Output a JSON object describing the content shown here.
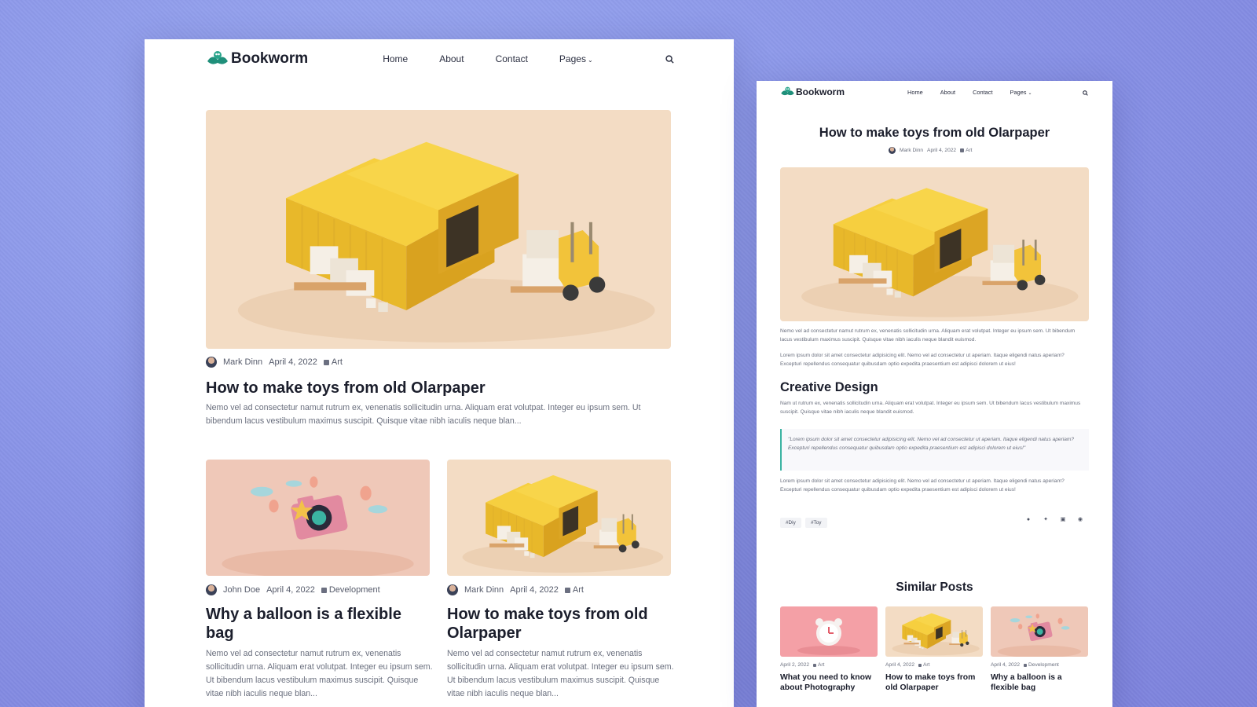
{
  "brand": {
    "name": "Bookworm"
  },
  "colors": {
    "background": "#8a95e8",
    "accent": "#3bb3a2",
    "title": "#1b1e2c"
  },
  "nav": {
    "home": "Home",
    "about": "About",
    "contact": "Contact",
    "pages": "Pages",
    "search_icon": "search-icon"
  },
  "left": {
    "featured": {
      "author": "Mark Dinn",
      "date": "April 4, 2022",
      "category": "Art",
      "title": "How to make toys from old Olarpaper",
      "excerpt": "Nemo vel ad consectetur namut rutrum ex, venenatis sollicitudin urna. Aliquam erat volutpat. Integer eu ipsum sem. Ut bibendum lacus vestibulum maximus suscipit. Quisque vitae nibh iaculis neque blan..."
    },
    "posts": [
      {
        "author": "John Doe",
        "date": "April 4, 2022",
        "category": "Development",
        "title": "Why a balloon is a flexible bag",
        "excerpt": "Nemo vel ad consectetur namut rutrum ex, venenatis sollicitudin urna. Aliquam erat volutpat. Integer eu ipsum sem. Ut bibendum lacus vestibulum maximus suscipit. Quisque vitae nibh iaculis neque blan..."
      },
      {
        "author": "Mark Dinn",
        "date": "April 4, 2022",
        "category": "Art",
        "title": "How to make toys from old Olarpaper",
        "excerpt": "Nemo vel ad consectetur namut rutrum ex, venenatis sollicitudin urna. Aliquam erat volutpat. Integer eu ipsum sem. Ut bibendum lacus vestibulum maximus suscipit. Quisque vitae nibh iaculis neque blan..."
      }
    ]
  },
  "right": {
    "title": "How to make toys from old Olarpaper",
    "author": "Mark Dinn",
    "date": "April 4, 2022",
    "category": "Art",
    "para1": "Nemo vel ad consectetur namut rutrum ex, venenatis sollicitudin urna. Aliquam erat volutpat. Integer eu ipsum sem. Ut bibendum lacus vestibulum maximus suscipit. Quisque vitae nibh iaculis neque blandit euismod.",
    "para2": "Lorem ipsum dolor sit amet consectetur adipisicing elit. Nemo vel ad consectetur ut aperiam. Itaque eligendi natus aperiam? Excepturi repellendus consequatur quibusdam optio expedita praesentium est adipisci dolorem ut eius!",
    "section_title": "Creative Design",
    "para3": "Nam ut rutrum ex, venenatis sollicitudin urna. Aliquam erat volutpat. Integer eu ipsum sem. Ut bibendum lacus vestibulum maximus suscipit. Quisque vitae nibh iaculis neque blandit euismod.",
    "quote": "\"Lorem ipsum dolor sit amet consectetur adipisicing elit. Nemo vel ad consectetur ut aperiam. Itaque eligendi natus aperiam? Excepturi repellendus consequatur quibusdam optio expedita praesentium est adipisci dolorem ut eius!\"",
    "para4": "Lorem ipsum dolor sit amet consectetur adipisicing elit. Nemo vel ad consectetur ut aperiam. Itaque eligendi natus aperiam? Excepturi repellendus consequatur quibusdam optio expedita praesentium est adipisci dolorem ut eius!",
    "tags": [
      "#Diy",
      "#Toy"
    ],
    "social_icons": [
      "facebook-icon",
      "twitter-icon",
      "linkedin-icon",
      "pinterest-icon"
    ],
    "similar_title": "Similar Posts",
    "similar": [
      {
        "date": "April 2, 2022",
        "category": "Art",
        "title": "What you need to know about Photography"
      },
      {
        "date": "April 4, 2022",
        "category": "Art",
        "title": "How to make toys from old Olarpaper"
      },
      {
        "date": "April 4, 2022",
        "category": "Development",
        "title": "Why a balloon is a flexible bag"
      }
    ]
  }
}
